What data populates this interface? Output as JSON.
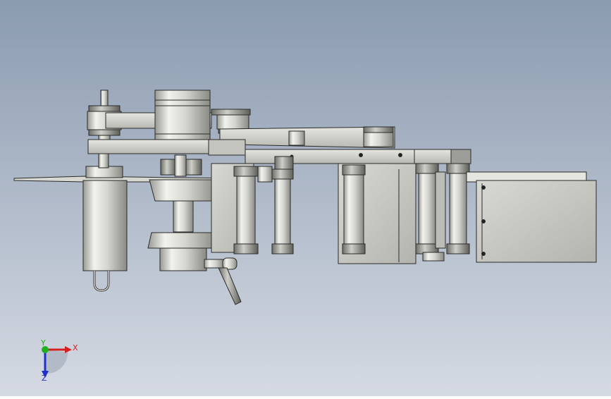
{
  "scene": {
    "background_top": "#8B9BB0",
    "background_bottom": "#D5DAE3",
    "metal_light": "#EDEDE8",
    "metal_mid": "#C9C9C2",
    "metal_dark": "#8E8E88",
    "edge_color": "#2A2A2A"
  },
  "triad": {
    "x_label": "X",
    "y_label": "Y",
    "z_label": "Z",
    "x_color": "#D42020",
    "y_color": "#20B020",
    "z_color": "#2030C8"
  }
}
